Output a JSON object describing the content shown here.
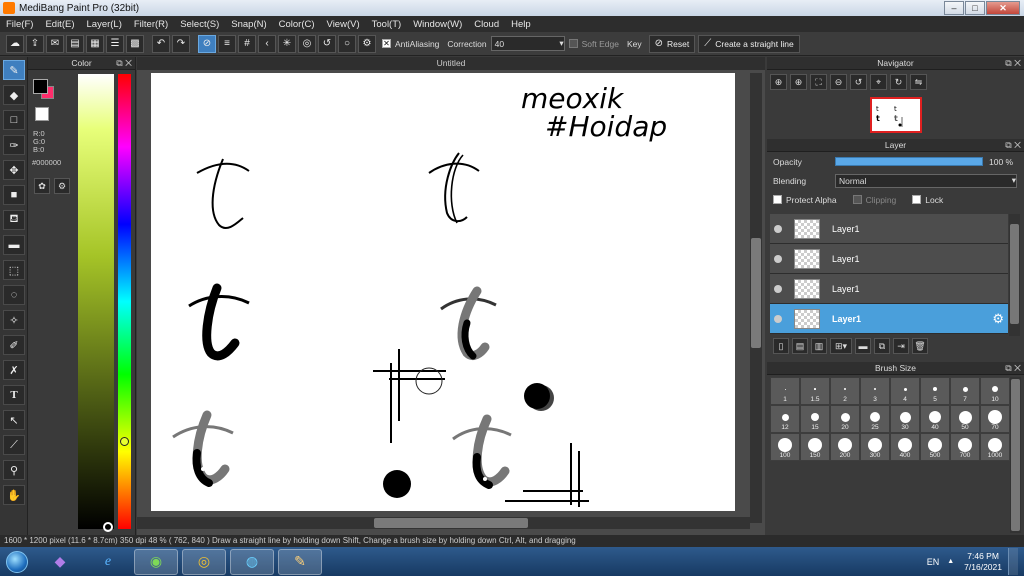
{
  "window": {
    "title": "MediBang Paint Pro (32bit)",
    "min": "–",
    "max": "□",
    "close": "✕"
  },
  "menu": [
    "File(F)",
    "Edit(E)",
    "Layer(L)",
    "Filter(R)",
    "Select(S)",
    "Snap(N)",
    "Color(C)",
    "View(V)",
    "Tool(T)",
    "Window(W)",
    "Cloud",
    "Help"
  ],
  "toolbar": {
    "antialias_label": "AntiAliasing",
    "antialias_checked": "✕",
    "correction_label": "Correction",
    "correction_value": "40",
    "soft_edge_label": "Soft Edge",
    "key_label": "Key",
    "reset_label": "Reset",
    "straight_line_label": "Create a straight line"
  },
  "color_panel": {
    "title": "Color",
    "r": "R:0",
    "g": "G:0",
    "b": "B:0",
    "hex": "#000000",
    "main_color": "#000000",
    "sub_color": "#ff2d6b"
  },
  "canvas": {
    "tab_title": "Untitled"
  },
  "navigator": {
    "title": "Navigator"
  },
  "layer_panel": {
    "title": "Layer",
    "opacity_label": "Opacity",
    "opacity_value": "100 %",
    "opacity_fraction": 1.0,
    "blending_label": "Blending",
    "blending_value": "Normal",
    "protect_alpha_label": "Protect Alpha",
    "clipping_label": "Clipping",
    "lock_label": "Lock",
    "layers": [
      {
        "name": "Layer1"
      },
      {
        "name": "Layer1"
      },
      {
        "name": "Layer1"
      },
      {
        "name": "Layer1"
      }
    ],
    "selected_index": 3
  },
  "brush_panel": {
    "title": "Brush Size",
    "sizes": [
      "1",
      "1.5",
      "2",
      "3",
      "4",
      "5",
      "7",
      "10",
      "12",
      "15",
      "20",
      "25",
      "30",
      "40",
      "50",
      "70",
      "100",
      "150",
      "200",
      "300",
      "400",
      "500",
      "700",
      "1000"
    ]
  },
  "status": {
    "text": "1600 * 1200 pixel   (11.6 * 8.7cm)   350 dpi   48 %   ( 762, 840 )   Draw a straight line by holding down Shift, Change a brush size by holding down Ctrl, Alt, and dragging"
  },
  "taskbar": {
    "lang": "EN",
    "time": "7:46 PM",
    "date": "7/16/2021"
  },
  "canvas_text": {
    "line1": "meoxik",
    "line2": "#Hoidap"
  }
}
